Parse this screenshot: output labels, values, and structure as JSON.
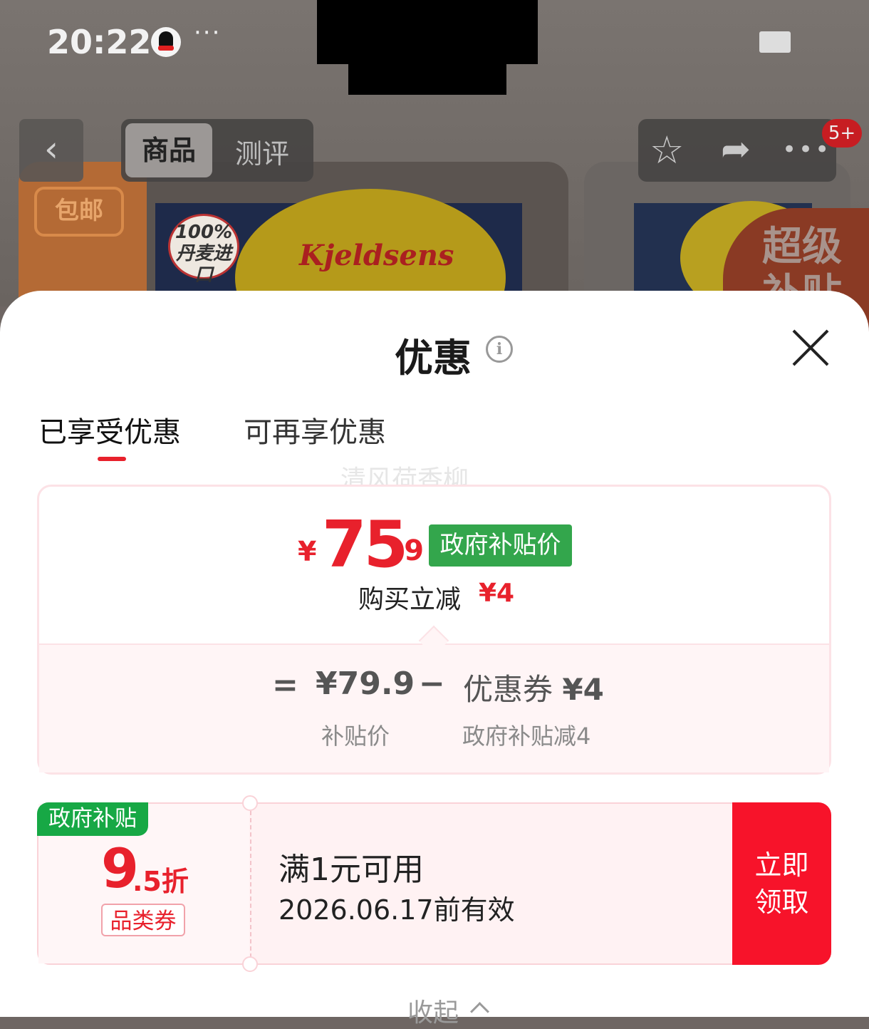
{
  "status_bar": {
    "time": "20:22",
    "more": "···"
  },
  "nav": {
    "back": "‹",
    "tabs": [
      "商品",
      "测评"
    ],
    "notification_badge": "5+"
  },
  "product": {
    "free_shipping": "包邮",
    "import_badge": "100%\n丹麦进口",
    "brand": "Kjeldsens",
    "side_badge": "超级\n补贴"
  },
  "sheet": {
    "title": "优惠",
    "tabs": [
      "已享受优惠",
      "可再享优惠"
    ],
    "watermark": "清风荷香柳"
  },
  "price_summary": {
    "currency": "¥",
    "price_integer": "75",
    "price_decimal": ".9",
    "price_tag": "政府补贴价",
    "instant_discount_label": "购买立减",
    "instant_discount_value": "¥4",
    "equals": "=",
    "subsidy_price": "¥79.9",
    "minus": "−",
    "coupon_label": "优惠券",
    "coupon_value": "¥4",
    "subsidy_price_caption": "补贴价",
    "coupon_caption": "政府补贴减4"
  },
  "coupon": {
    "badge": "政府补贴",
    "discount_integer": "9",
    "discount_rest": ".5折",
    "type_tag": "品类券",
    "condition": "满1元可用",
    "validity": "2026.06.17前有效",
    "claim_button": "立即\n领取"
  },
  "footer": {
    "collapse": "收起"
  },
  "colors": {
    "accent_red": "#e8212c",
    "gov_green": "#33a64c",
    "claim_red": "#f7132a"
  }
}
